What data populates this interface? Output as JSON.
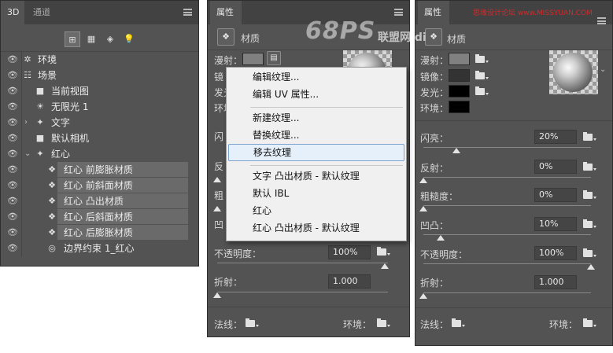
{
  "layers_panel": {
    "tabs": [
      "3D",
      "通道"
    ],
    "layers": [
      {
        "label": "环境",
        "icon": "environment-icon",
        "eye": true
      },
      {
        "label": "场景",
        "icon": "scene-icon",
        "eye": true
      },
      {
        "label": "当前视图",
        "icon": "camera-icon",
        "eye": true
      },
      {
        "label": "无限光 1",
        "icon": "light-icon",
        "eye": true
      },
      {
        "label": "文字",
        "icon": "mesh-icon",
        "eye": true,
        "collapsed": true
      },
      {
        "label": "默认相机",
        "icon": "camera-icon",
        "eye": true
      },
      {
        "label": "红心",
        "icon": "mesh-icon",
        "eye": true,
        "expanded": true
      },
      {
        "label": "红心  前膨胀材质",
        "icon": "material-icon",
        "eye": true,
        "selected": true
      },
      {
        "label": "红心  前斜面材质",
        "icon": "material-icon",
        "eye": true,
        "selected": true
      },
      {
        "label": "红心  凸出材质",
        "icon": "material-icon",
        "eye": true,
        "selected": true
      },
      {
        "label": "红心  后斜面材质",
        "icon": "material-icon",
        "eye": true,
        "selected": true
      },
      {
        "label": "红心  后膨胀材质",
        "icon": "material-icon",
        "eye": true,
        "selected": true
      },
      {
        "label": "边界约束 1_红心",
        "icon": "constraint-icon",
        "eye": true
      }
    ]
  },
  "properties_panel_1": {
    "tab": "属性",
    "header": "材质",
    "rows_visible": [
      "漫射：",
      "镜",
      "发光",
      "环境"
    ],
    "shine_label": "闪",
    "reflection_label": "反",
    "roughness_label": "粗",
    "bump_label": "凹",
    "opacity_label": "不透明度：",
    "opacity_value": "100%",
    "refraction_label": "折射：",
    "refraction_value": "1.000",
    "normal_label": "法线：",
    "environment_label": "环境："
  },
  "context_menu": {
    "items": [
      "编辑纹理...",
      "编辑 UV 属性...",
      "新建纹理...",
      "替换纹理...",
      "移去纹理",
      "文字 凸出材质 - 默认纹理",
      "默认 IBL",
      "红心",
      "红心  凸出材质 - 默认纹理"
    ],
    "highlighted": "移去纹理"
  },
  "properties_panel_2": {
    "tab": "属性",
    "header": "材质",
    "diffuse_label": "漫射：",
    "specular_label": "镜像：",
    "illumination_label": "发光：",
    "ambient_label": "环境：",
    "shine_label": "闪亮：",
    "shine_value": "20%",
    "reflection_label": "反射：",
    "reflection_value": "0%",
    "roughness_label": "粗糙度：",
    "roughness_value": "0%",
    "bump_label": "凹凸：",
    "bump_value": "10%",
    "opacity_label": "不透明度：",
    "opacity_value": "100%",
    "refraction_label": "折射：",
    "refraction_value": "1.000",
    "normal_label": "法线：",
    "environment_label": "环境："
  },
  "watermarks": {
    "logo": "68PS",
    "site_name": "联盟网 di",
    "top_right": "思缘设计论坛 www.MISSYUAN.COM"
  },
  "colors": {
    "panel_bg": "#535353",
    "tabbar_bg": "#424242",
    "diffuse_swatch": "#808080",
    "specular_swatch": "#333333",
    "black_swatch": "#000000",
    "menu_highlight": "#e5f0fa"
  }
}
